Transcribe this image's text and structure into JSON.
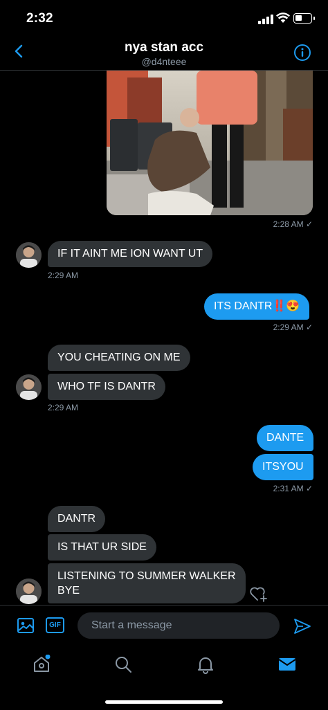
{
  "status": {
    "time": "2:32"
  },
  "header": {
    "title": "nya stan acc",
    "handle": "@d4nteee"
  },
  "messages": [
    {
      "ts": "2:28 AM ✓"
    },
    {
      "text": "IF IT AINT ME ION WANT UT",
      "ts": "2:29 AM"
    },
    {
      "text": "ITS DANTR‼️😍",
      "ts": "2:29 AM ✓"
    },
    {
      "text": "YOU CHEATING ON ME"
    },
    {
      "text": "WHO TF IS DANTR",
      "ts": "2:29 AM"
    },
    {
      "text": "DANTE"
    },
    {
      "text": "ITSYOU",
      "ts": "2:31 AM ✓"
    },
    {
      "text": "DANTR"
    },
    {
      "text": "IS THAT UR SIDE"
    },
    {
      "text_line1": "LISTENING TO SUMMER WALKER",
      "text_line2": "BYE"
    }
  ],
  "composer": {
    "gif_label": "GIF",
    "placeholder": "Start a message"
  },
  "colors": {
    "accent": "#1d9bf0",
    "incoming": "#2f3336",
    "background": "#000000",
    "muted": "#8b98a5"
  },
  "icons": {
    "back": "chevron-left-icon",
    "info": "info-icon",
    "image": "image-icon",
    "send": "send-icon",
    "tabs": [
      "home-icon",
      "search-icon",
      "bell-icon",
      "mail-icon"
    ],
    "react": "heart-plus-icon"
  }
}
